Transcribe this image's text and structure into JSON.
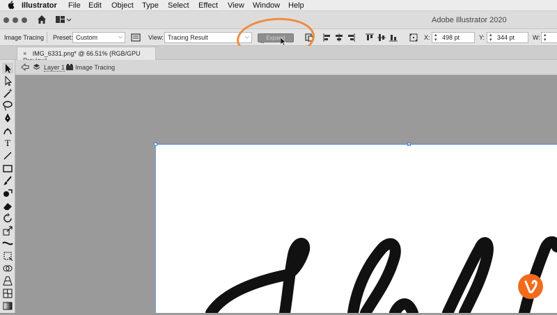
{
  "menubar": {
    "apple_icon": "apple-icon",
    "app_name": "Illustrator",
    "items": [
      "File",
      "Edit",
      "Object",
      "Type",
      "Select",
      "Effect",
      "View",
      "Window",
      "Help"
    ]
  },
  "titlebar": {
    "title": "Adobe Illustrator 2020"
  },
  "controlbar": {
    "mode_label": "Image Tracing",
    "preset_label": "Preset:",
    "preset_value": "Custom",
    "view_label": "View:",
    "view_value": "Tracing Result",
    "expand_label": "Expand",
    "x_label": "X:",
    "x_value": "498 pt",
    "y_label": "Y:",
    "y_value": "344 pt",
    "w_label": "W:"
  },
  "document": {
    "tab_close": "×",
    "tab_title": "IMG_6331.png* @ 66.51% (RGB/GPU Preview)"
  },
  "breadcrumb": {
    "layer": "Layer 1",
    "item": "Image Tracing"
  },
  "colors": {
    "highlight": "#f08a3c",
    "badge": "#f26b1d",
    "selection": "#4a7fe0"
  }
}
